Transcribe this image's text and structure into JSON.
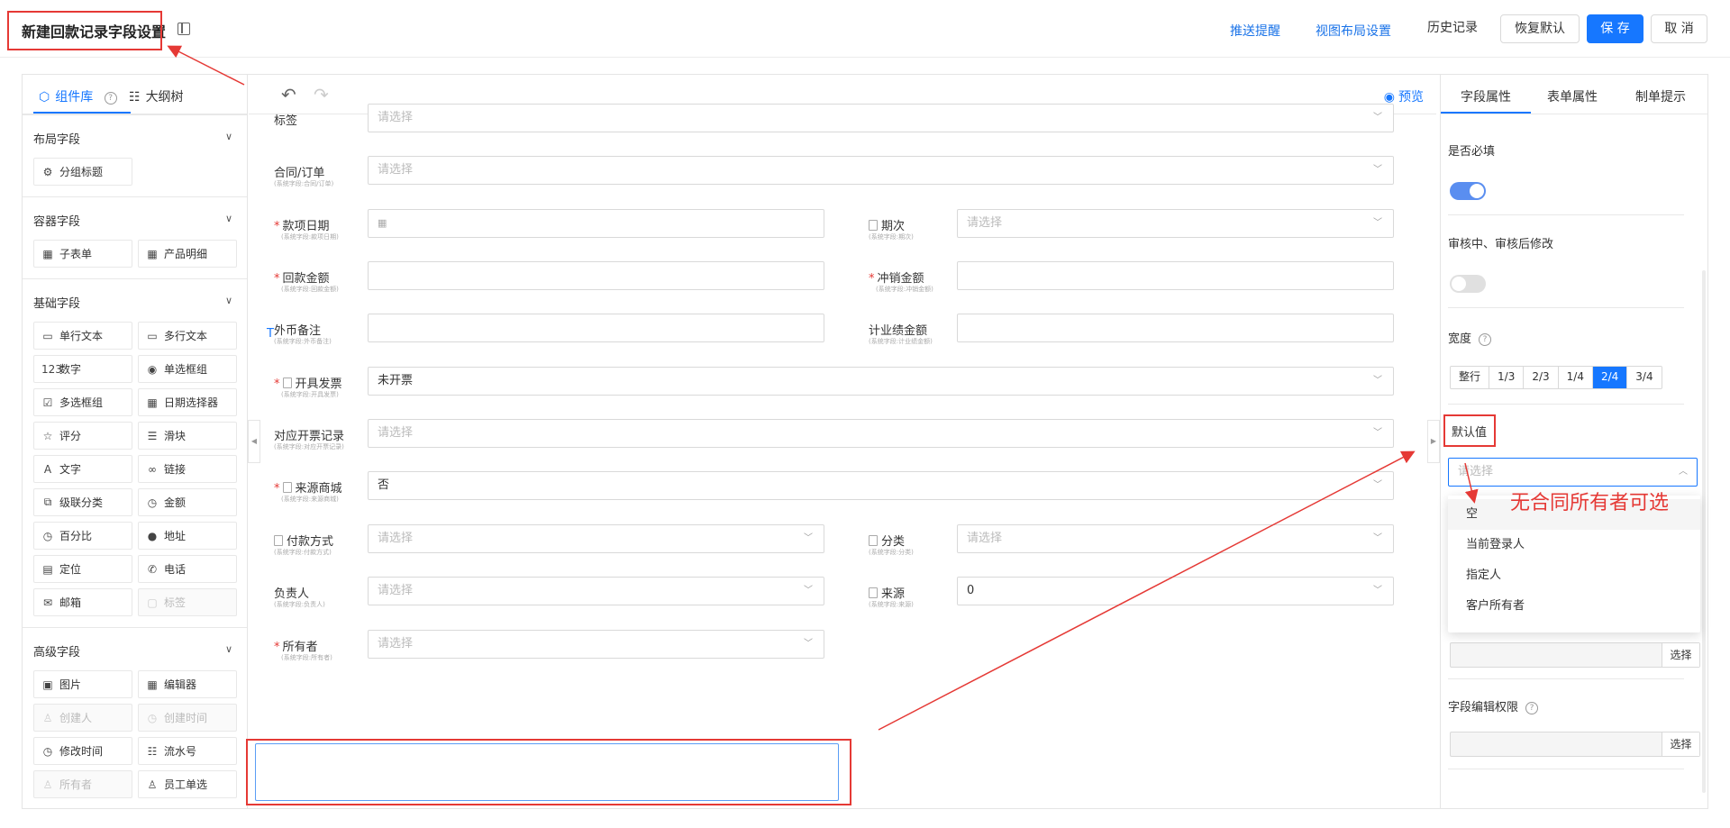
{
  "header": {
    "title": "新建回款记录字段设置",
    "links": [
      "推送提醒",
      "视图布局设置"
    ],
    "history": "历史记录",
    "restore": "恢复默认",
    "save": "保 存",
    "cancel": "取 消"
  },
  "left_panel": {
    "tabs": [
      "组件库",
      "大纲树"
    ],
    "sections": [
      {
        "title": "布局字段",
        "items": [
          {
            "label": "分组标题",
            "icon": "group-title-icon",
            "glyph": "⚙",
            "disabled": false
          }
        ]
      },
      {
        "title": "容器字段",
        "items": [
          {
            "label": "子表单",
            "icon": "subform-icon",
            "glyph": "▦",
            "disabled": false
          },
          {
            "label": "产品明细",
            "icon": "product-detail-icon",
            "glyph": "▦",
            "disabled": false
          }
        ]
      },
      {
        "title": "基础字段",
        "items": [
          {
            "label": "单行文本",
            "icon": "single-line-text-icon",
            "glyph": "▭",
            "disabled": false
          },
          {
            "label": "多行文本",
            "icon": "multi-line-text-icon",
            "glyph": "▭",
            "disabled": false
          },
          {
            "label": "数字",
            "icon": "number-icon",
            "glyph": "123",
            "disabled": false
          },
          {
            "label": "单选框组",
            "icon": "radio-group-icon",
            "glyph": "◉",
            "disabled": false
          },
          {
            "label": "多选框组",
            "icon": "checkbox-group-icon",
            "glyph": "☑",
            "disabled": false
          },
          {
            "label": "日期选择器",
            "icon": "date-picker-icon",
            "glyph": "▦",
            "disabled": false
          },
          {
            "label": "评分",
            "icon": "rating-icon",
            "glyph": "☆",
            "disabled": false
          },
          {
            "label": "滑块",
            "icon": "slider-icon",
            "glyph": "☰",
            "disabled": false
          },
          {
            "label": "文字",
            "icon": "text-icon",
            "glyph": "A",
            "disabled": false
          },
          {
            "label": "链接",
            "icon": "link-icon",
            "glyph": "∞",
            "disabled": false
          },
          {
            "label": "级联分类",
            "icon": "cascade-icon",
            "glyph": "⧉",
            "disabled": false
          },
          {
            "label": "金额",
            "icon": "amount-icon",
            "glyph": "◷",
            "disabled": false
          },
          {
            "label": "百分比",
            "icon": "percent-icon",
            "glyph": "◷",
            "disabled": false
          },
          {
            "label": "地址",
            "icon": "location-pin-icon",
            "glyph": "●",
            "disabled": false
          },
          {
            "label": "定位",
            "icon": "position-icon",
            "glyph": "▤",
            "disabled": false
          },
          {
            "label": "电话",
            "icon": "phone-icon",
            "glyph": "✆",
            "disabled": false
          },
          {
            "label": "邮箱",
            "icon": "mail-icon",
            "glyph": "✉",
            "disabled": false
          },
          {
            "label": "标签",
            "icon": "tag-icon",
            "glyph": "▢",
            "disabled": true
          }
        ]
      },
      {
        "title": "高级字段",
        "items": [
          {
            "label": "图片",
            "icon": "image-icon",
            "glyph": "▣",
            "disabled": false
          },
          {
            "label": "编辑器",
            "icon": "editor-icon",
            "glyph": "▦",
            "disabled": false
          },
          {
            "label": "创建人",
            "icon": "creator-icon",
            "glyph": "♙",
            "disabled": true
          },
          {
            "label": "创建时间",
            "icon": "create-time-icon",
            "glyph": "◷",
            "disabled": true
          },
          {
            "label": "修改时间",
            "icon": "modify-time-icon",
            "glyph": "◷",
            "disabled": false
          },
          {
            "label": "流水号",
            "icon": "serial-number-icon",
            "glyph": "☷",
            "disabled": false
          },
          {
            "label": "所有者",
            "icon": "owner-icon",
            "glyph": "♙",
            "disabled": true
          },
          {
            "label": "员工单选",
            "icon": "employee-icon",
            "glyph": "♙",
            "disabled": false
          }
        ]
      }
    ]
  },
  "center": {
    "preview": "预览",
    "cursor_marker": "T",
    "fields": [
      {
        "label": "标签",
        "sub": "",
        "required": false,
        "doc": false,
        "value": "请选择",
        "filled": false,
        "dropdown": true
      },
      {
        "label": "合同/订单",
        "sub": "(系统字段:合同/订单)",
        "required": false,
        "doc": false,
        "value": "请选择",
        "filled": false,
        "dropdown": true
      },
      {
        "label": "款项日期",
        "sub": "(系统字段:款项日期)",
        "required": true,
        "doc": false,
        "value": "",
        "filled": false,
        "dropdown": false,
        "calendar": true
      },
      {
        "label": "期次",
        "sub": "(系统字段:期次)",
        "required": false,
        "doc": true,
        "value": "请选择",
        "filled": false,
        "dropdown": true
      },
      {
        "label": "回款金额",
        "sub": "(系统字段:回款金额)",
        "required": true,
        "doc": false,
        "value": "",
        "filled": false,
        "dropdown": false
      },
      {
        "label": "冲销金额",
        "sub": "(系统字段:冲销金额)",
        "required": true,
        "doc": false,
        "value": "",
        "filled": false,
        "dropdown": false
      },
      {
        "label": "外币备注",
        "sub": "(系统字段:外币备注)",
        "required": false,
        "doc": false,
        "value": "",
        "filled": false,
        "dropdown": false
      },
      {
        "label": "计业绩金额",
        "sub": "(系统字段:计业绩金额)",
        "required": false,
        "doc": false,
        "value": "",
        "filled": false,
        "dropdown": false
      },
      {
        "label": "开具发票",
        "sub": "(系统字段:开具发票)",
        "required": true,
        "doc": true,
        "value": "未开票",
        "filled": true,
        "dropdown": true
      },
      {
        "label": "对应开票记录",
        "sub": "(系统字段:对应开票记录)",
        "required": false,
        "doc": false,
        "value": "请选择",
        "filled": false,
        "dropdown": true
      },
      {
        "label": "来源商城",
        "sub": "(系统字段:来源商城)",
        "required": true,
        "doc": true,
        "value": "否",
        "filled": true,
        "dropdown": true
      },
      {
        "label": "付款方式",
        "sub": "(系统字段:付款方式)",
        "required": false,
        "doc": true,
        "value": "请选择",
        "filled": false,
        "dropdown": true
      },
      {
        "label": "分类",
        "sub": "(系统字段:分类)",
        "required": false,
        "doc": true,
        "value": "请选择",
        "filled": false,
        "dropdown": true
      },
      {
        "label": "负责人",
        "sub": "(系统字段:负责人)",
        "required": false,
        "doc": false,
        "value": "请选择",
        "filled": false,
        "dropdown": true
      },
      {
        "label": "来源",
        "sub": "(系统字段:来源)",
        "required": false,
        "doc": true,
        "value": "0",
        "filled": true,
        "dropdown": true
      },
      {
        "label": "所有者",
        "sub": "(系统字段:所有者)",
        "required": true,
        "doc": false,
        "value": "请选择",
        "filled": false,
        "dropdown": true
      }
    ]
  },
  "right_panel": {
    "tabs": [
      "字段属性",
      "表单属性",
      "制单提示"
    ],
    "required_label": "是否必填",
    "required_on": true,
    "review_label": "审核中、审核后修改",
    "review_on": false,
    "width_label": "宽度",
    "width_options": [
      "整行",
      "1/3",
      "2/3",
      "1/4",
      "2/4",
      "3/4"
    ],
    "width_selected": "2/4",
    "default_label": "默认值",
    "default_placeholder": "请选择",
    "dropdown_options": [
      "空",
      "当前登录人",
      "指定人",
      "客户所有者"
    ],
    "select_button": "选择",
    "edit_perm_label": "字段编辑权限"
  },
  "annotation": {
    "text": "无合同所有者可选",
    "color": "#e53935"
  },
  "colors": {
    "accent": "#1677ff",
    "annotation": "#e53935",
    "toggle_on": "#5a8ef0"
  }
}
